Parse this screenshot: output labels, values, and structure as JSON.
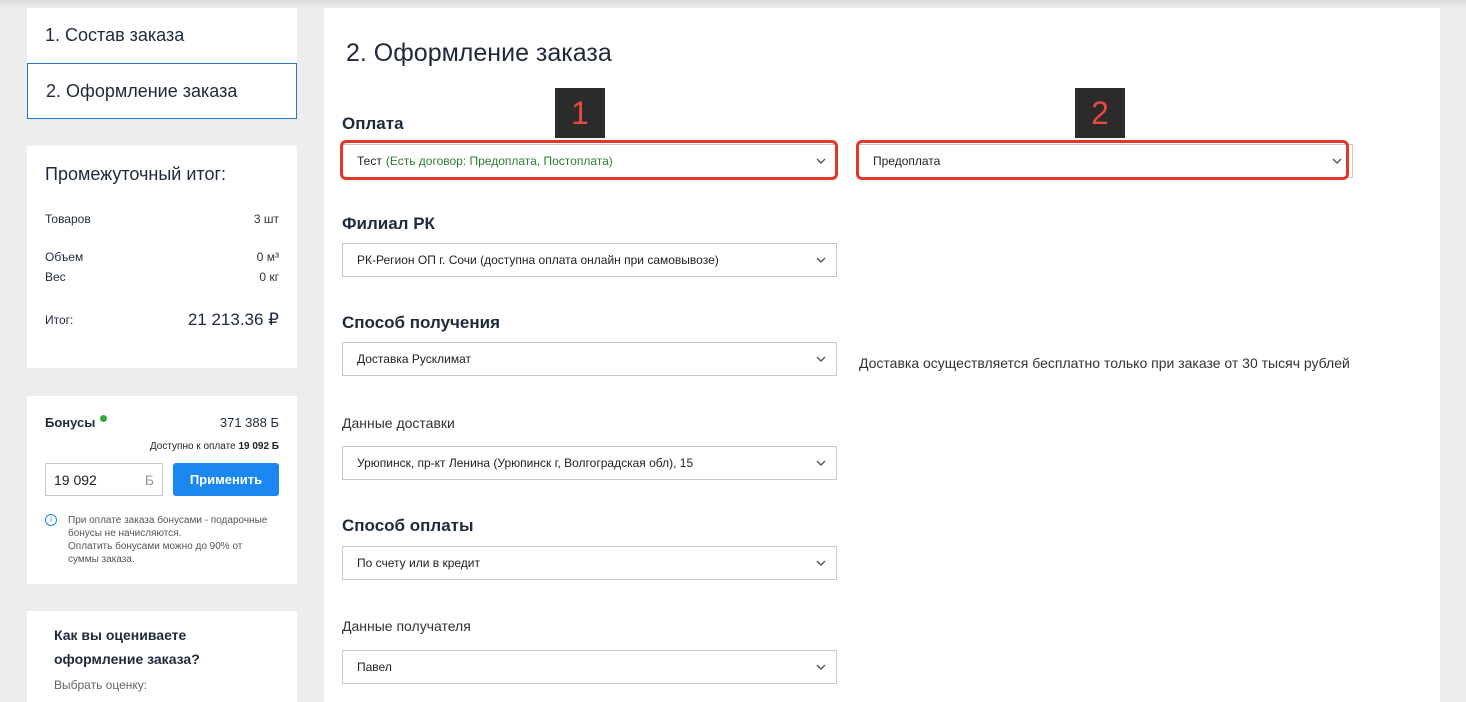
{
  "steps": {
    "step1": "1. Состав заказа",
    "step2": "2. Оформление заказа"
  },
  "summary": {
    "title": "Промежуточный итог:",
    "goods_label": "Товаров",
    "goods_value": "3 шт",
    "volume_label": "Объем",
    "volume_value": "0 м³",
    "weight_label": "Вес",
    "weight_value": "0 кг",
    "total_label": "Итог:",
    "total_value": "21 213.36 ₽"
  },
  "bonus": {
    "label": "Бонусы",
    "balance": "371 388 Б",
    "available_prefix": "Доступно к оплате",
    "available_value": "19 092 Б",
    "input_value": "19 092",
    "input_currency": "Б",
    "apply_button": "Применить",
    "info_line1": "При оплате заказа бонусами - подарочные бонусы не начисляются.",
    "info_line2": "Оплатить бонусами можно до 90% от суммы заказа."
  },
  "rating": {
    "question": "Как вы оцениваете оформление заказа?",
    "choose": "Выбрать оценку:"
  },
  "main": {
    "title": "2. Оформление заказа",
    "payment_label": "Оплата",
    "payment_contract_main": "Тест",
    "payment_contract_note": "(Есть договор: Предоплата, Постоплата)",
    "payment_type": "Предоплата",
    "branch_label": "Филиал РК",
    "branch_value": "РК-Регион ОП г. Сочи (доступна оплата онлайн при самовывозе)",
    "receive_label": "Способ получения",
    "receive_value": "Доставка Русклимат",
    "receive_note": "Доставка осуществляется бесплатно только при заказе от 30 тысяч рублей",
    "delivery_label": "Данные доставки",
    "delivery_value": "Урюпинск, пр-кт Ленина (Урюпинск г, Волгоградская обл), 15",
    "paymethod_label": "Способ оплаты",
    "paymethod_value": "По счету или в кредит",
    "recipient_label": "Данные получателя",
    "recipient_value": "Павел"
  },
  "annotations": {
    "badge1": "1",
    "badge2": "2",
    "highlight_color": "#e0362c"
  }
}
